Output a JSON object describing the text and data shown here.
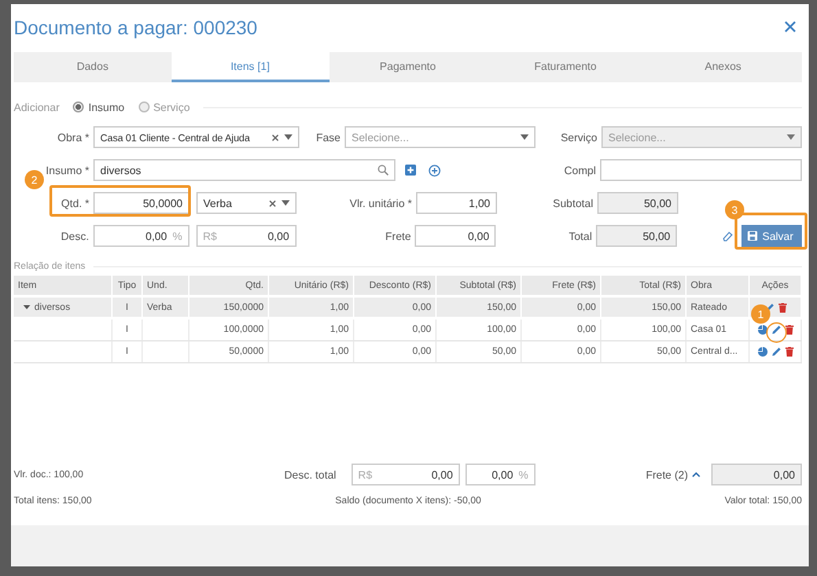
{
  "window": {
    "title": "Documento a pagar: 000230"
  },
  "tabs": [
    {
      "label": "Dados",
      "selected": false
    },
    {
      "label": "Itens [1]",
      "selected": true
    },
    {
      "label": "Pagamento",
      "selected": false
    },
    {
      "label": "Faturamento",
      "selected": false
    },
    {
      "label": "Anexos",
      "selected": false
    }
  ],
  "add": {
    "label": "Adicionar",
    "options": [
      {
        "label": "Insumo",
        "selected": true
      },
      {
        "label": "Serviço",
        "selected": false
      }
    ]
  },
  "form": {
    "obra": {
      "label": "Obra *",
      "value": "Casa 01 Cliente - Central de Ajuda"
    },
    "fase": {
      "label": "Fase",
      "placeholder": "Selecione..."
    },
    "servico": {
      "label": "Serviço",
      "placeholder": "Selecione...",
      "disabled": true
    },
    "insumo": {
      "label": "Insumo *",
      "value": "diversos"
    },
    "compl": {
      "label": "Compl"
    },
    "qtd": {
      "label": "Qtd. *",
      "value": "50,0000"
    },
    "unidade": {
      "value": "Verba"
    },
    "vlr_unitario": {
      "label": "Vlr. unitário *",
      "value": "1,00"
    },
    "subtotal": {
      "label": "Subtotal",
      "value": "50,00"
    },
    "desc": {
      "label": "Desc.",
      "value": "0,00",
      "unit": "%"
    },
    "desc_valor": {
      "prefix": "R$",
      "value": "0,00"
    },
    "frete": {
      "label": "Frete",
      "value": "0,00"
    },
    "total": {
      "label": "Total",
      "value": "50,00"
    },
    "save_button": "Salvar"
  },
  "items_section": "Relação de itens",
  "table": {
    "columns": [
      "Item",
      "Tipo",
      "Und.",
      "Qtd.",
      "Unitário (R$)",
      "Desconto (R$)",
      "Subtotal (R$)",
      "Frete (R$)",
      "Total (R$)",
      "Obra",
      "Ações"
    ],
    "rows": [
      {
        "expanded": true,
        "cells": {
          "item": "diversos",
          "tipo": "I",
          "und": "Verba",
          "qtd": "150,0000",
          "unitario": "1,00",
          "desconto": "0,00",
          "subtotal": "150,00",
          "frete": "0,00",
          "total": "150,00",
          "obra": "Rateado"
        },
        "children": [
          {
            "cells": {
              "tipo": "I",
              "qtd": "100,0000",
              "unitario": "1,00",
              "desconto": "0,00",
              "subtotal": "100,00",
              "frete": "0,00",
              "total": "100,00",
              "obra": "Casa 01"
            }
          },
          {
            "cells": {
              "tipo": "I",
              "qtd": "50,0000",
              "unitario": "1,00",
              "desconto": "0,00",
              "subtotal": "50,00",
              "frete": "0,00",
              "total": "50,00",
              "obra": "Central d..."
            }
          }
        ]
      }
    ]
  },
  "footer": {
    "vlr_doc": "Vlr. doc.: 100,00",
    "desc_total": {
      "label": "Desc. total",
      "prefix": "R$",
      "value": "0,00",
      "percent": "0,00",
      "unit": "%"
    },
    "frete": {
      "label": "Frete (2)",
      "expanded": true,
      "value": "0,00"
    },
    "total_itens": "Total itens: 150,00",
    "saldo": "Saldo (documento X itens): -50,00",
    "valor_total": "Valor total: 150,00"
  },
  "annotations": [
    "1",
    "2",
    "3"
  ]
}
